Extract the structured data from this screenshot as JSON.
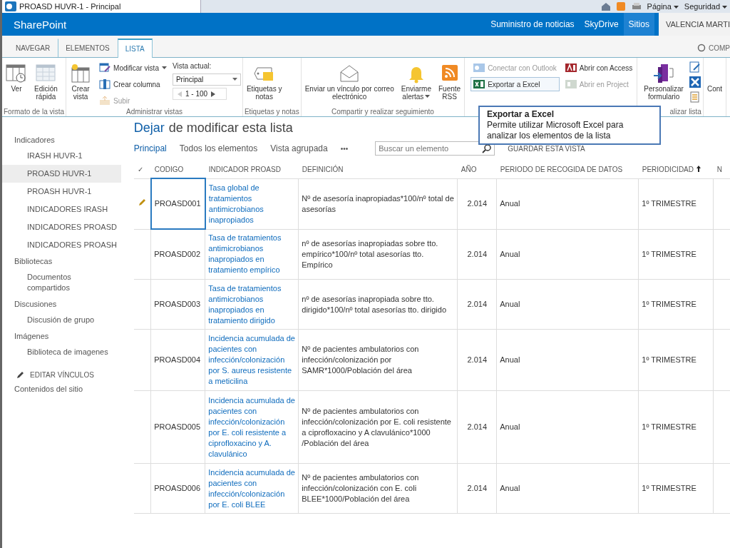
{
  "browser": {
    "tab_title": "PROASD HUVR-1 - Principal",
    "menus": [
      {
        "label": "Página"
      },
      {
        "label": "Seguridad"
      }
    ]
  },
  "suite_bar": {
    "brand": "SharePoint",
    "links": [
      {
        "label": "Suministro de noticias",
        "selected": false
      },
      {
        "label": "SkyDrive",
        "selected": false
      },
      {
        "label": "Sitios",
        "selected": true
      }
    ],
    "user": "VALENCIA MARTI"
  },
  "ribbon_tabs": [
    {
      "label": "NAVEGAR",
      "selected": false
    },
    {
      "label": "ELEMENTOS",
      "selected": false
    },
    {
      "label": "LISTA",
      "selected": true
    }
  ],
  "ribbon_right": "COMP",
  "ribbon_groups": [
    {
      "label": "Formato de la vista",
      "columns": [
        [
          {
            "kind": "large",
            "label": [
              "Ver"
            ],
            "disabled": false
          }
        ],
        [
          {
            "kind": "large",
            "label": [
              "Edición",
              "rápida"
            ],
            "disabled": false
          }
        ]
      ]
    },
    {
      "label": "Administrar vistas",
      "columns": [
        [
          {
            "kind": "large",
            "label": [
              "Crear",
              "vista"
            ],
            "disabled": false
          }
        ],
        [
          {
            "kind": "small",
            "label": "Modificar vista",
            "caret": true,
            "disabled": false
          },
          {
            "kind": "small",
            "label": "Crear columna",
            "disabled": false
          },
          {
            "kind": "small",
            "label": "Subir",
            "disabled": true
          }
        ],
        [
          {
            "kind": "caption",
            "label": "Vista actual:"
          },
          {
            "kind": "dropdown",
            "value": "Principal"
          },
          {
            "kind": "pager",
            "label": "1 - 100"
          }
        ]
      ]
    },
    {
      "label": "Etiquetas y notas",
      "columns": [
        [
          {
            "kind": "large",
            "label": [
              "Etiquetas y",
              "notas"
            ],
            "disabled": false
          }
        ]
      ]
    },
    {
      "label": "Compartir y realizar seguimiento",
      "columns": [
        [
          {
            "kind": "large",
            "label": [
              "Enviar un vínculo por correo",
              "electrónico"
            ],
            "disabled": false
          }
        ],
        [
          {
            "kind": "large",
            "label": [
              "Enviarme",
              "alertas"
            ],
            "caret": true,
            "disabled": false
          }
        ],
        [
          {
            "kind": "large",
            "label": [
              "Fuente",
              "RSS"
            ],
            "disabled": false
          }
        ]
      ]
    },
    {
      "columns": [
        [
          {
            "kind": "small",
            "label": "Conectar con Outlook",
            "disabled": true
          },
          {
            "kind": "small",
            "label": "Exportar a Excel",
            "disabled": false,
            "selected": true
          }
        ],
        [
          {
            "kind": "small",
            "label": "Abrir con Access",
            "disabled": false
          },
          {
            "kind": "small",
            "label": "Abrir en Project",
            "disabled": true
          }
        ]
      ]
    },
    {
      "label": "alizar lista",
      "columns": [
        [
          {
            "kind": "large",
            "label": [
              "Personalizar",
              "formulario"
            ],
            "disabled": false
          }
        ],
        [
          {
            "kind": "icon"
          },
          {
            "kind": "icon"
          },
          {
            "kind": "icon"
          }
        ]
      ]
    },
    {
      "columns": [
        [
          {
            "kind": "large",
            "label": [
              "Cont"
            ],
            "disabled": false
          }
        ]
      ]
    }
  ],
  "tooltip": {
    "title": "Exportar a Excel",
    "body": "Permite utilizar Microsoft Excel para analizar los elementos de la lista"
  },
  "sidebar": {
    "sections": [
      {
        "label": "Indicadores",
        "children": [
          {
            "label": "IRASH HUVR-1",
            "selected": false
          },
          {
            "label": "PROASD HUVR-1",
            "selected": true
          },
          {
            "label": "PROASH HUVR-1",
            "selected": false
          },
          {
            "label": "INDICADORES IRASH",
            "selected": false
          },
          {
            "label": "INDICADORES PROASD",
            "selected": false
          },
          {
            "label": "INDICADORES PROASH",
            "selected": false
          }
        ]
      },
      {
        "label": "Bibliotecas",
        "children": [
          {
            "label": "Documentos compartidos",
            "selected": false
          }
        ]
      },
      {
        "label": "Discusiones",
        "children": [
          {
            "label": "Discusión de grupo",
            "selected": false
          }
        ]
      },
      {
        "label": "Imágenes",
        "children": [
          {
            "label": "Biblioteca de imagenes",
            "selected": false
          }
        ]
      }
    ],
    "edit_links": "EDITAR VÍNCULOS",
    "site_contents": "Contenidos del sitio"
  },
  "page": {
    "title_link": "Dejar",
    "title_rest": "de modificar esta lista",
    "views": [
      {
        "label": "Principal",
        "selected": true
      },
      {
        "label": "Todos los elementos",
        "selected": false
      },
      {
        "label": "Vista agrupada",
        "selected": false
      }
    ],
    "more": "•••",
    "search": {
      "placeholder": "Buscar un elemento"
    },
    "save_view": "GUARDAR ESTA VISTA"
  },
  "table": {
    "check_header": "✓",
    "columns": [
      {
        "label": "CODIGO",
        "sorted": false
      },
      {
        "label": "INDICADOR PROASD",
        "sorted": false
      },
      {
        "label": "DEFINICIÓN",
        "sorted": false
      },
      {
        "label": "AÑO",
        "sorted": false
      },
      {
        "label": "PERIODO DE RECOGIDA DE DATOS",
        "sorted": false
      },
      {
        "label": "PERIODICIDAD",
        "sorted": true
      },
      {
        "label": "N",
        "sorted": false
      }
    ],
    "rows": [
      {
        "editing": true,
        "focused": true,
        "code": "PROASD001",
        "indicator": "Tasa global de tratamientos antimicrobianos inapropiados",
        "definition": "Nº de asesoría inapropiadas*100/nº total de asesorías",
        "year": "2.014",
        "period": "Anual",
        "periodicity": "1º TRIMESTRE"
      },
      {
        "editing": false,
        "focused": false,
        "code": "PROASD002",
        "indicator": "Tasa de tratamientos antimicrobianos inapropiados en tratamiento empírico",
        "definition": "nº de asesorías inapropiadas sobre tto. empírico*100/nº total asesorías tto. Empírico",
        "year": "2.014",
        "period": "Anual",
        "periodicity": "1º TRIMESTRE"
      },
      {
        "editing": false,
        "focused": false,
        "code": "PROASD003",
        "indicator": "Tasa de tratamientos antimicrobianos inapropiados en tratamiento dirigido",
        "definition": "nº de asesorías inapropiada sobre tto. dirigido*100/nº total asesorías tto. dirigido",
        "year": "2.014",
        "period": "Anual",
        "periodicity": "1º TRIMESTRE"
      },
      {
        "editing": false,
        "focused": false,
        "code": "PROASD004",
        "indicator": "Incidencia acumulada de pacientes con infección/colonización por S. aureus resistente a meticilina",
        "definition": "Nº de pacientes ambulatorios con infección/colonización por SAMR*1000/Población del área",
        "year": "2.014",
        "period": "Anual",
        "periodicity": "1º TRIMESTRE"
      },
      {
        "editing": false,
        "focused": false,
        "code": "PROASD005",
        "indicator": "Incidencia acumulada de pacientes con infección/colonización por E. coli resistente a ciprofloxacino y A. clavulánico",
        "definition": "Nº de pacientes ambulatorios con infección/colonización por E. coli resistente a ciprofloxacino y A clavulánico*1000 /Población del área",
        "year": "2.014",
        "period": "Anual",
        "periodicity": "1º TRIMESTRE"
      },
      {
        "editing": false,
        "focused": false,
        "code": "PROASD006",
        "indicator": "Incidencia acumulada de pacientes con infección/colonización por E. coli BLEE",
        "definition": "Nº de pacientes ambulatorios con infección/colonización con E. coli BLEE*1000/Población del área",
        "year": "2.014",
        "period": "Anual",
        "periodicity": "1º TRIMESTRE"
      }
    ]
  }
}
